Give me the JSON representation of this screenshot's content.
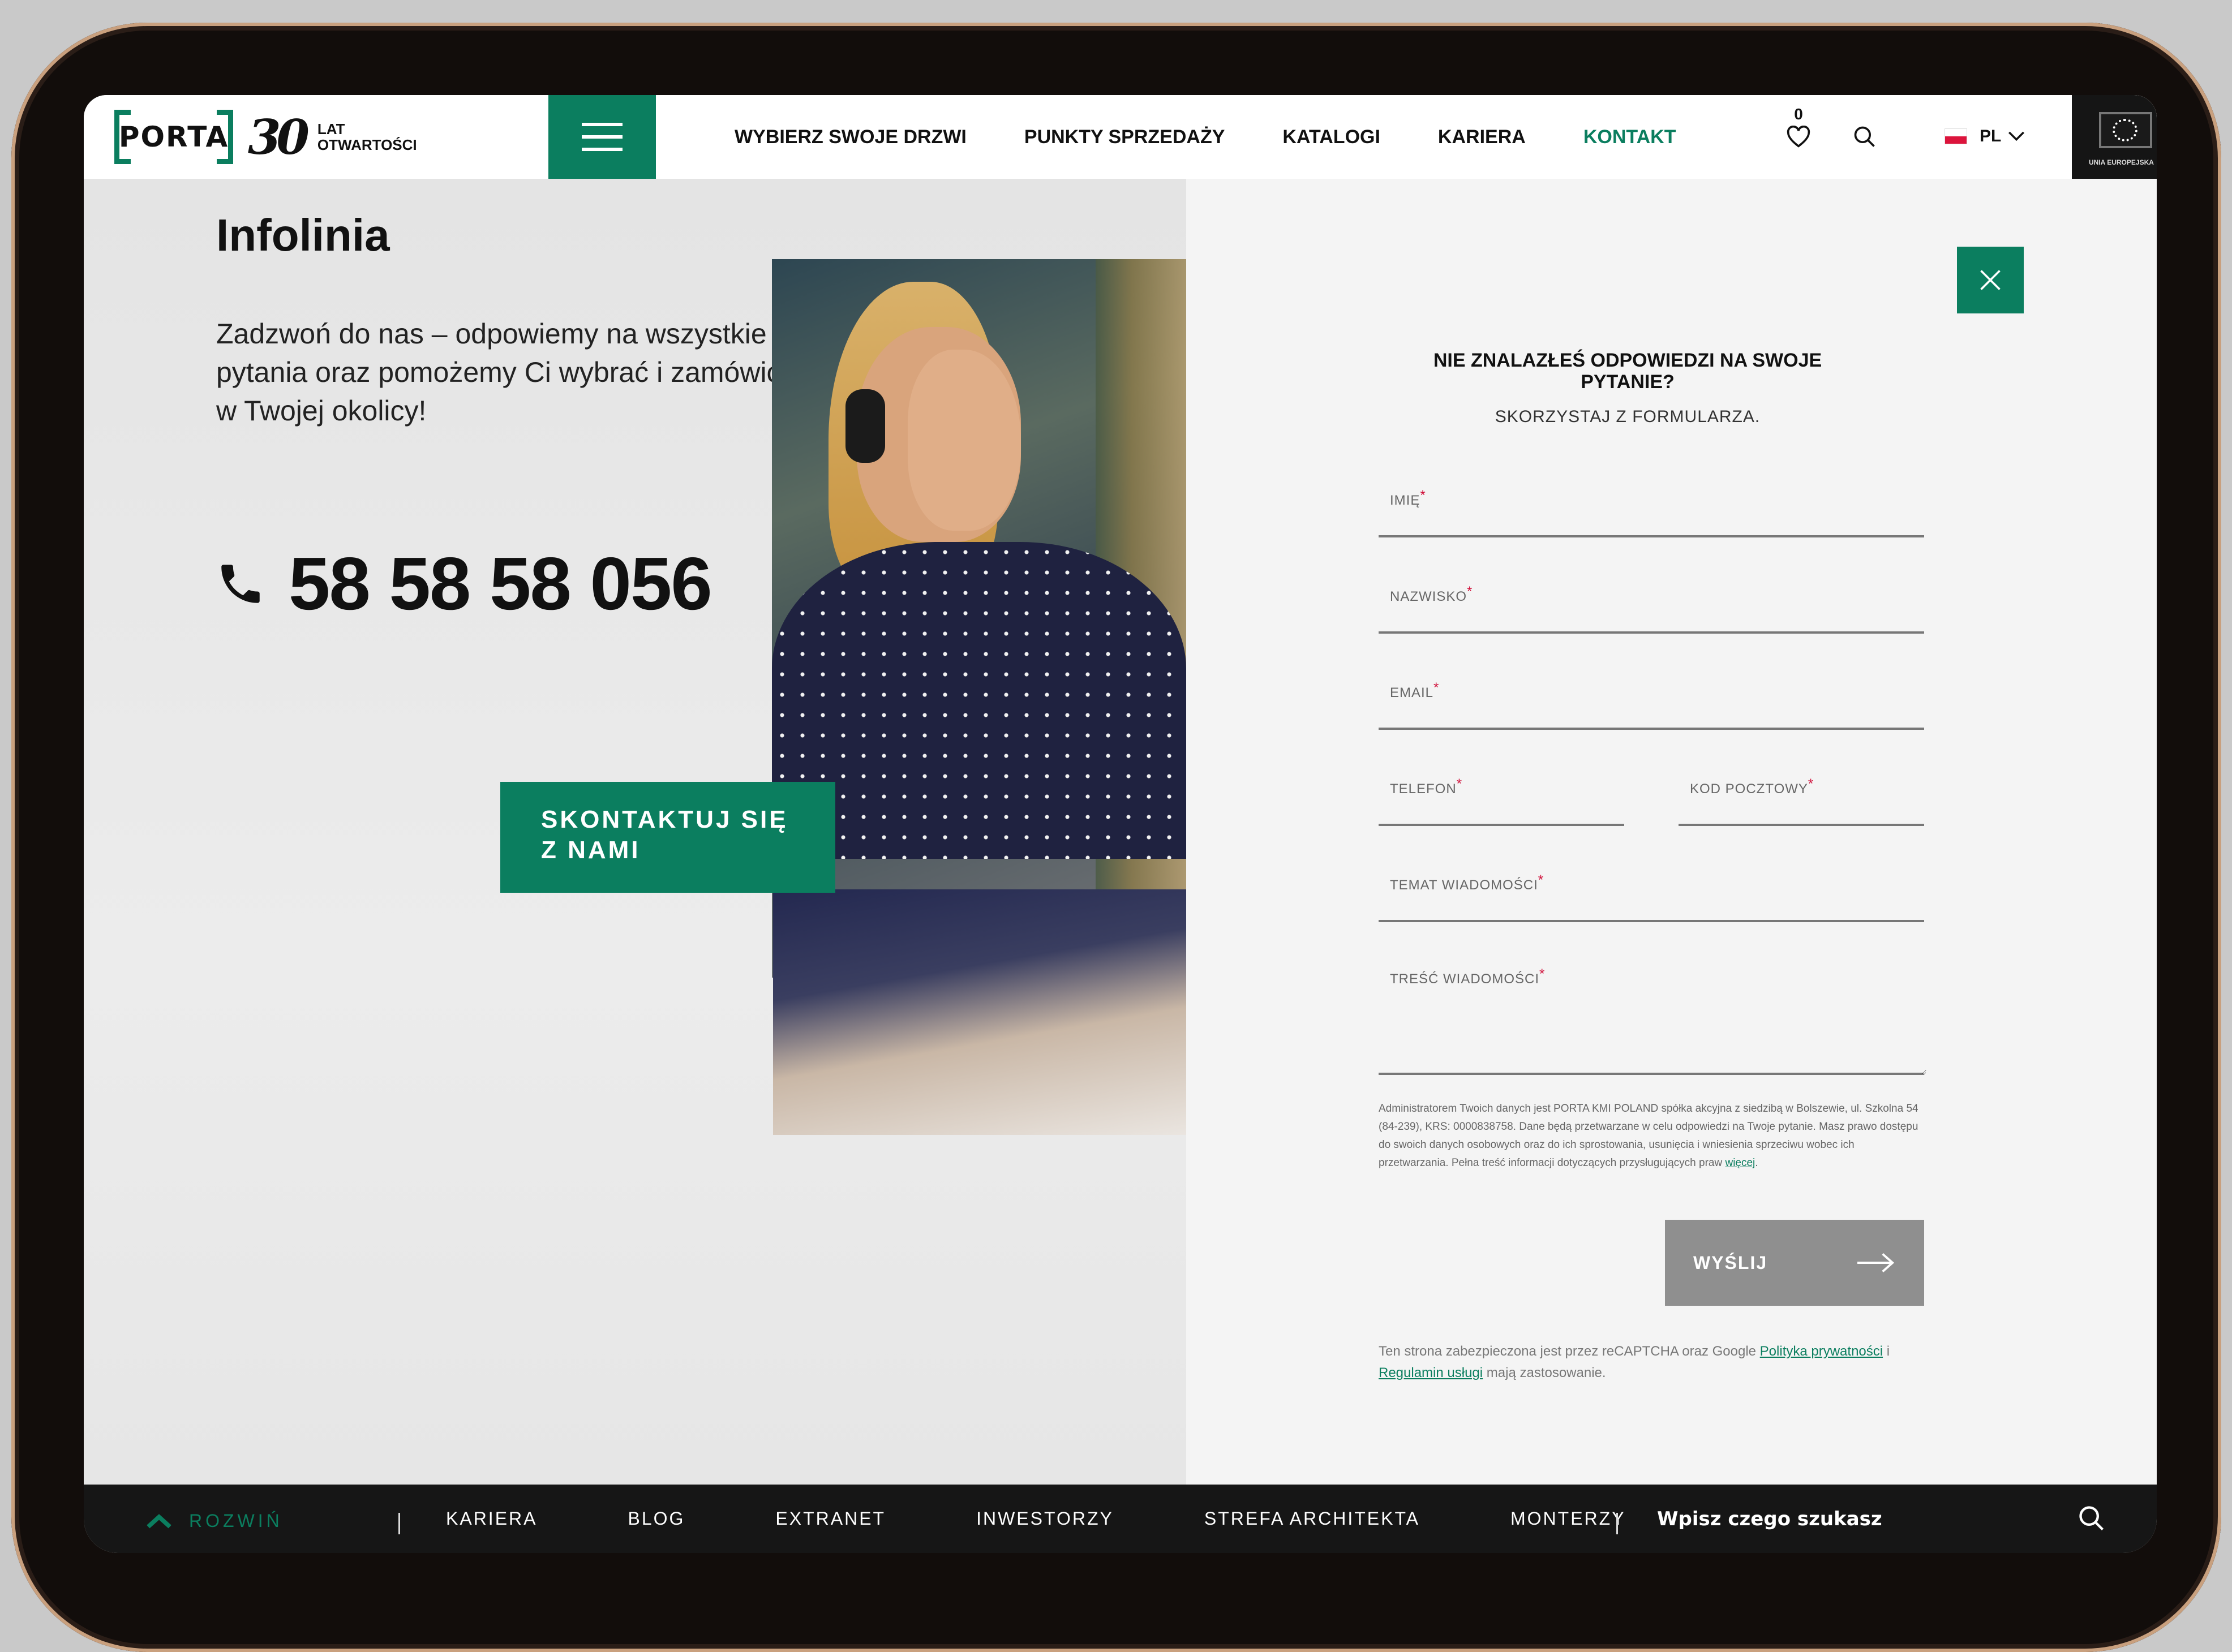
{
  "header": {
    "logo_text": "PORTA",
    "anniversary_number": "30",
    "anniversary_line1": "LAT",
    "anniversary_line2": "OTWARTOŚCI",
    "nav": [
      {
        "label": "WYBIERZ SWOJE DRZWI"
      },
      {
        "label": "PUNKTY SPRZEDAŻY"
      },
      {
        "label": "KATALOGI"
      },
      {
        "label": "KARIERA"
      },
      {
        "label": "KONTAKT",
        "active": true
      }
    ],
    "favorites_count": "0",
    "language": "PL",
    "eu_label": "UNIA EUROPEJSKA"
  },
  "icons": [
    "hamburger-icon",
    "heart-icon",
    "search-icon",
    "chevron-down-icon",
    "phone-icon",
    "close-icon",
    "arrow-right-icon",
    "chevron-up-icon"
  ],
  "colors": {
    "brand_green": "#0b7e5f",
    "send_gray": "#8f8f8f",
    "required_red": "#d0103a"
  },
  "infoline": {
    "title": "Infolinia",
    "intro": "Zadzwoń do nas – odpowiemy na wszystkie Twoje pytania oraz pomożemy Ci wybrać i zamówić drzwi w Twojej okolicy!",
    "phone": "58 58 58 056",
    "cta": "SKONTAKTUJ SIĘ Z NAMI"
  },
  "form": {
    "heading": "NIE ZNALAZŁEŚ ODPOWIEDZI NA SWOJE PYTANIE?",
    "subheading": "SKORZYSTAJ Z FORMULARZA.",
    "required_mark": "*",
    "fields": {
      "first_name": "IMIĘ",
      "last_name": "NAZWISKO",
      "email": "EMAIL",
      "phone": "TELEFON",
      "postal_code": "KOD POCZTOWY",
      "subject": "TEMAT WIADOMOŚCI",
      "message": "TREŚĆ WIADOMOŚCI"
    },
    "consent_text": "Administratorem Twoich danych jest PORTA KMI POLAND spółka akcyjna z siedzibą w Bolszewie, ul. Szkolna 54 (84-239), KRS: 0000838758. Dane będą przetwarzane w celu odpowiedzi na Twoje pytanie. Masz prawo dostępu do swoich danych osobowych oraz do ich sprostowania, usunięcia i wniesienia sprzeciwu wobec ich przetwarzania. Pełna treść informacji dotyczących przysługujących praw",
    "consent_link": "więcej",
    "consent_end": ".",
    "submit": "WYŚLIJ",
    "captcha_pre": "Ten strona zabezpieczona jest przez reCAPTCHA oraz Google",
    "captcha_privacy": "Polityka prywatności",
    "captcha_and": "i",
    "captcha_terms": "Regulamin usługi",
    "captcha_post": "mają zastosowanie."
  },
  "footer": {
    "expand": "ROZWIŃ",
    "links": [
      {
        "label": "KARIERA"
      },
      {
        "label": "BLOG"
      },
      {
        "label": "EXTRANET"
      },
      {
        "label": "INWESTORZY"
      },
      {
        "label": "STREFA ARCHITEKTA"
      },
      {
        "label": "MONTERZY"
      }
    ],
    "search_placeholder": "Wpisz czego szukasz"
  }
}
